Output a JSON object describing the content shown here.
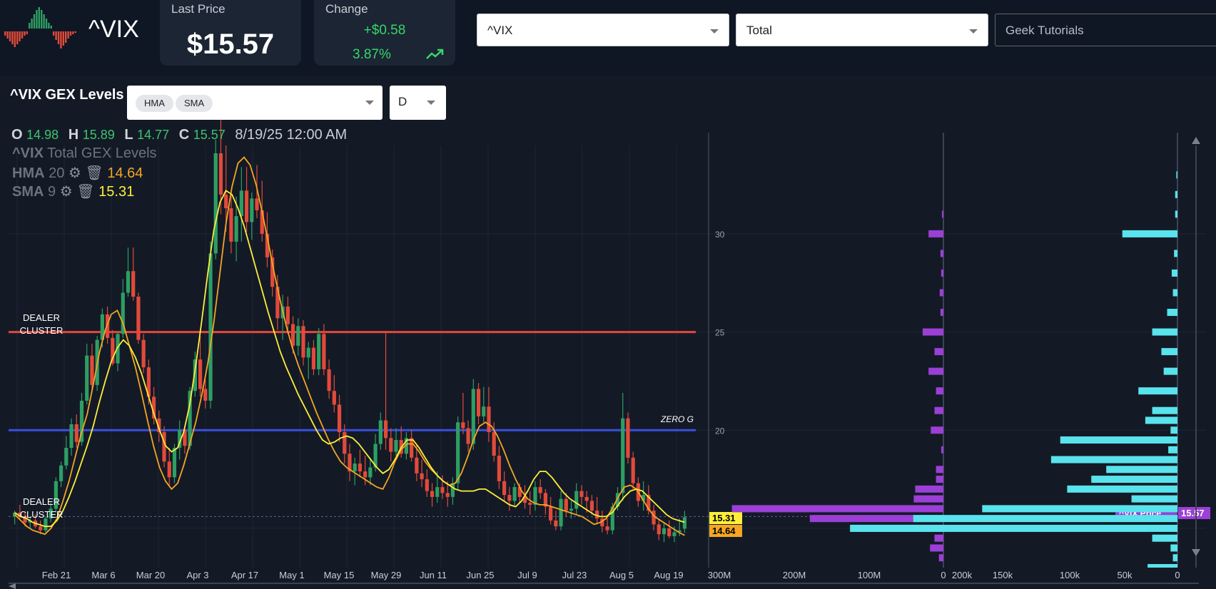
{
  "header": {
    "symbol": "^VIX",
    "last_price_label": "Last Price",
    "last_price": "$15.57",
    "change_label": "Change",
    "change_abs": "+$0.58",
    "change_pct": "3.87%",
    "symbol_select": "^VIX",
    "type_select": "Total",
    "tutorial_select": "Geek Tutorials"
  },
  "panel": {
    "title": "^VIX GEX Levels",
    "indicators": [
      "HMA",
      "SMA"
    ],
    "period": "D",
    "ohlc": {
      "o_label": "O",
      "o": "14.98",
      "h_label": "H",
      "h": "15.89",
      "l_label": "L",
      "l": "14.77",
      "c_label": "C",
      "c": "15.57",
      "datetime": "8/19/25 12:00 AM"
    },
    "legend": {
      "series_title": "^VIX",
      "series_subtitle": "Total GEX Levels",
      "hma_label": "HMA",
      "hma_period": "20",
      "hma_value": "14.64",
      "sma_label": "SMA",
      "sma_period": "9",
      "sma_value": "15.31"
    },
    "level_labels": {
      "dealer_top": [
        "DEALER",
        "CLUSTER"
      ],
      "zero_g": "ZERO G",
      "dealer_bottom": [
        "DEALER",
        "CLUSTER"
      ]
    },
    "price_tags": {
      "sma": "15.31",
      "hma": "14.64",
      "vix_price_label": "^VIX Price",
      "vix_price": "15.57"
    },
    "colors": {
      "up": "#2e9e63",
      "down": "#e24a3b",
      "hma": "#f5a623",
      "sma": "#ffee3a",
      "resistance": "#e6463c",
      "zero_gamma": "#3a4fe0",
      "call_bar": "#59e3ec",
      "put_bar": "#9b3fd6"
    }
  },
  "chart_data": {
    "type": "candlestick",
    "x_tick_labels": [
      "Feb 21",
      "Mar 6",
      "Mar 20",
      "Apr 3",
      "Apr 17",
      "May 1",
      "May 15",
      "May 29",
      "Jun 11",
      "Jun 25",
      "Jul 9",
      "Jul 23",
      "Aug 5",
      "Aug 19"
    ],
    "y_ticks": [
      20,
      25,
      30
    ],
    "ylim": [
      13.0,
      34.5
    ],
    "levels": {
      "dealer_cluster_upper": 25,
      "zero_gamma": 20,
      "dealer_cluster_lower": 15.6
    },
    "candles": [
      [
        15.6,
        15.9,
        15.2,
        15.8
      ],
      [
        15.8,
        16.2,
        15.5,
        15.6
      ],
      [
        15.6,
        15.8,
        15.1,
        15.3
      ],
      [
        15.3,
        15.6,
        15.0,
        15.4
      ],
      [
        15.4,
        15.7,
        15.0,
        15.1
      ],
      [
        15.1,
        15.4,
        14.7,
        14.9
      ],
      [
        14.9,
        15.6,
        14.8,
        15.5
      ],
      [
        15.5,
        16.3,
        15.3,
        16.0
      ],
      [
        16.0,
        17.6,
        15.8,
        17.4
      ],
      [
        17.4,
        18.4,
        17.1,
        18.2
      ],
      [
        18.2,
        19.7,
        18.0,
        19.1
      ],
      [
        19.1,
        20.6,
        18.7,
        20.3
      ],
      [
        20.3,
        20.8,
        19.1,
        19.4
      ],
      [
        19.4,
        21.9,
        19.2,
        21.5
      ],
      [
        21.5,
        24.4,
        21.3,
        23.8
      ],
      [
        23.8,
        24.4,
        21.9,
        22.3
      ],
      [
        22.3,
        24.8,
        22.0,
        24.6
      ],
      [
        24.6,
        26.2,
        24.2,
        25.9
      ],
      [
        25.9,
        26.3,
        24.4,
        24.7
      ],
      [
        24.7,
        25.1,
        23.3,
        23.4
      ],
      [
        23.4,
        25.0,
        23.0,
        24.9
      ],
      [
        24.9,
        27.7,
        24.7,
        27.0
      ],
      [
        27.0,
        29.3,
        26.8,
        28.1
      ],
      [
        28.1,
        29.3,
        26.6,
        26.8
      ],
      [
        26.8,
        27.0,
        24.4,
        24.6
      ],
      [
        24.6,
        24.9,
        22.9,
        23.2
      ],
      [
        23.2,
        23.6,
        21.3,
        21.7
      ],
      [
        21.7,
        22.2,
        20.3,
        20.6
      ],
      [
        20.6,
        21.0,
        19.4,
        19.9
      ],
      [
        19.9,
        20.2,
        18.1,
        18.4
      ],
      [
        18.4,
        19.1,
        17.1,
        17.6
      ],
      [
        17.6,
        19.3,
        17.3,
        19.1
      ],
      [
        19.1,
        20.5,
        18.5,
        20.0
      ],
      [
        20.0,
        20.2,
        18.8,
        19.2
      ],
      [
        19.2,
        22.2,
        19.0,
        22.0
      ],
      [
        22.0,
        24.0,
        21.7,
        23.6
      ],
      [
        23.6,
        24.8,
        21.7,
        22.1
      ],
      [
        22.1,
        22.6,
        21.1,
        21.5
      ],
      [
        21.5,
        29.6,
        21.1,
        29.0
      ],
      [
        29.0,
        34.8,
        28.7,
        34.1
      ],
      [
        34.1,
        36.0,
        31.0,
        32.0
      ],
      [
        32.0,
        34.5,
        30.1,
        31.3
      ],
      [
        31.3,
        32.2,
        29.0,
        29.6
      ],
      [
        29.6,
        31.9,
        28.6,
        30.9
      ],
      [
        30.9,
        33.4,
        29.6,
        32.2
      ],
      [
        32.2,
        33.4,
        30.1,
        30.6
      ],
      [
        30.6,
        32.1,
        29.7,
        31.8
      ],
      [
        31.8,
        33.5,
        30.8,
        31.2
      ],
      [
        31.2,
        32.7,
        29.6,
        30.0
      ],
      [
        30.0,
        31.1,
        28.3,
        28.8
      ],
      [
        28.8,
        29.2,
        26.8,
        27.3
      ],
      [
        27.3,
        27.9,
        25.1,
        25.7
      ],
      [
        25.7,
        26.9,
        24.6,
        26.3
      ],
      [
        26.3,
        26.8,
        24.9,
        25.4
      ],
      [
        25.4,
        25.8,
        23.9,
        24.3
      ],
      [
        24.3,
        25.7,
        23.8,
        25.3
      ],
      [
        25.3,
        25.6,
        23.3,
        23.7
      ],
      [
        23.7,
        24.5,
        22.6,
        24.2
      ],
      [
        24.2,
        24.6,
        22.8,
        23.1
      ],
      [
        23.1,
        25.2,
        22.8,
        24.9
      ],
      [
        24.9,
        25.4,
        22.8,
        23.1
      ],
      [
        23.1,
        23.6,
        21.6,
        22.0
      ],
      [
        22.0,
        22.8,
        20.9,
        21.3
      ],
      [
        21.3,
        21.8,
        19.4,
        19.9
      ],
      [
        19.9,
        20.3,
        18.3,
        18.8
      ],
      [
        18.8,
        19.3,
        17.4,
        17.9
      ],
      [
        17.9,
        18.6,
        17.2,
        18.3
      ],
      [
        18.3,
        19.0,
        17.6,
        17.9
      ],
      [
        17.9,
        18.7,
        17.2,
        17.6
      ],
      [
        17.6,
        18.6,
        17.2,
        18.1
      ],
      [
        18.1,
        19.8,
        17.9,
        19.3
      ],
      [
        19.3,
        20.9,
        19.0,
        20.5
      ],
      [
        20.5,
        25.0,
        19.0,
        19.6
      ],
      [
        19.6,
        20.1,
        18.4,
        18.9
      ],
      [
        18.9,
        20.1,
        18.7,
        19.5
      ],
      [
        19.5,
        20.2,
        18.6,
        18.8
      ],
      [
        18.8,
        19.9,
        18.5,
        19.6
      ],
      [
        19.6,
        20.0,
        18.4,
        18.6
      ],
      [
        18.6,
        19.3,
        17.4,
        17.8
      ],
      [
        17.8,
        18.5,
        17.1,
        17.5
      ],
      [
        17.5,
        18.0,
        16.6,
        16.9
      ],
      [
        16.9,
        17.3,
        16.1,
        16.6
      ],
      [
        16.6,
        17.9,
        16.3,
        17.1
      ],
      [
        17.1,
        17.7,
        16.5,
        16.8
      ],
      [
        16.8,
        17.4,
        16.1,
        16.6
      ],
      [
        16.6,
        17.6,
        16.2,
        17.3
      ],
      [
        17.3,
        20.7,
        17.0,
        20.4
      ],
      [
        20.4,
        21.9,
        19.8,
        20.1
      ],
      [
        20.1,
        20.5,
        18.9,
        19.3
      ],
      [
        19.3,
        22.6,
        19.0,
        22.1
      ],
      [
        22.1,
        22.4,
        20.3,
        20.7
      ],
      [
        20.7,
        22.2,
        20.4,
        21.2
      ],
      [
        21.2,
        22.2,
        19.4,
        19.9
      ],
      [
        19.9,
        20.4,
        18.4,
        18.7
      ],
      [
        18.7,
        19.2,
        17.0,
        17.4
      ],
      [
        17.4,
        17.9,
        16.4,
        16.7
      ],
      [
        16.7,
        17.1,
        15.9,
        16.4
      ],
      [
        16.4,
        17.3,
        16.1,
        17.1
      ],
      [
        17.1,
        17.3,
        16.3,
        16.6
      ],
      [
        16.6,
        17.2,
        16.0,
        16.3
      ],
      [
        16.3,
        16.9,
        15.7,
        16.2
      ],
      [
        16.2,
        17.4,
        15.9,
        17.1
      ],
      [
        17.1,
        17.5,
        16.5,
        16.8
      ],
      [
        16.8,
        17.0,
        15.7,
        16.1
      ],
      [
        16.1,
        16.6,
        15.2,
        15.4
      ],
      [
        15.4,
        15.9,
        14.9,
        15.1
      ],
      [
        15.1,
        16.9,
        14.9,
        16.5
      ],
      [
        16.5,
        16.8,
        15.6,
        15.9
      ],
      [
        15.9,
        16.4,
        15.5,
        16.0
      ],
      [
        16.0,
        17.3,
        15.7,
        16.9
      ],
      [
        16.9,
        17.2,
        16.2,
        16.6
      ],
      [
        16.6,
        16.9,
        15.8,
        16.4
      ],
      [
        16.4,
        16.7,
        15.7,
        15.9
      ],
      [
        15.9,
        16.6,
        15.2,
        15.5
      ],
      [
        15.5,
        15.9,
        14.8,
        15.1
      ],
      [
        15.1,
        15.5,
        14.7,
        14.9
      ],
      [
        14.9,
        16.3,
        14.7,
        16.1
      ],
      [
        16.1,
        17.1,
        15.9,
        16.8
      ],
      [
        16.8,
        21.9,
        16.4,
        20.6
      ],
      [
        20.6,
        20.9,
        18.3,
        18.6
      ],
      [
        18.6,
        18.9,
        17.0,
        17.3
      ],
      [
        17.3,
        17.6,
        16.1,
        16.4
      ],
      [
        16.4,
        17.4,
        15.9,
        16.7
      ],
      [
        16.7,
        17.2,
        15.7,
        15.9
      ],
      [
        15.9,
        16.2,
        14.9,
        15.2
      ],
      [
        15.2,
        15.5,
        14.4,
        14.7
      ],
      [
        14.7,
        15.3,
        14.3,
        15.0
      ],
      [
        15.0,
        15.4,
        14.5,
        14.6
      ],
      [
        14.6,
        15.1,
        14.3,
        14.8
      ],
      [
        14.8,
        15.5,
        14.6,
        14.9
      ],
      [
        14.98,
        15.89,
        14.77,
        15.57
      ]
    ],
    "hma": [
      15.7,
      15.4,
      15.1,
      14.9,
      14.8,
      14.7,
      15.0,
      15.5,
      16.4,
      17.4,
      18.6,
      19.8,
      20.8,
      22.3,
      23.9,
      25.1,
      25.9,
      26.1,
      25.4,
      24.3,
      23.2,
      21.9,
      20.5,
      19.2,
      18.1,
      17.4,
      17.0,
      17.3,
      18.2,
      19.3,
      20.4,
      21.8,
      23.4,
      25.5,
      28.0,
      30.5,
      32.4,
      33.6,
      33.9,
      33.5,
      32.5,
      31.1,
      29.6,
      28.0,
      26.6,
      25.3,
      24.2,
      23.3,
      22.5,
      21.7,
      20.9,
      20.2,
      19.5,
      18.9,
      18.4,
      18.1,
      17.9,
      17.7,
      17.5,
      17.3,
      17.1,
      17.0,
      17.6,
      18.4,
      19.0,
      19.3,
      19.3,
      18.9,
      18.4,
      18.0,
      17.7,
      17.4,
      17.2,
      17.3,
      17.8,
      18.6,
      19.5,
      20.2,
      20.4,
      20.2,
      19.7,
      19.0,
      18.2,
      17.5,
      16.9,
      16.5,
      16.3,
      16.2,
      16.2,
      16.1,
      16.0,
      15.9,
      15.8,
      15.7,
      15.6,
      15.4,
      15.2,
      15.3,
      15.5,
      16.0,
      16.6,
      17.1,
      17.2,
      17.0,
      16.5,
      16.0,
      15.6,
      15.4,
      15.2,
      15.0,
      14.8,
      14.64
    ],
    "sma": [
      15.8,
      15.6,
      15.5,
      15.3,
      15.2,
      15.1,
      15.1,
      15.4,
      15.9,
      16.6,
      17.4,
      18.3,
      19.2,
      20.2,
      21.4,
      22.5,
      23.5,
      24.2,
      24.6,
      24.3,
      23.7,
      22.9,
      21.9,
      20.9,
      20.0,
      19.2,
      18.9,
      19.1,
      19.9,
      21.3,
      23.3,
      25.6,
      28.0,
      30.2,
      31.6,
      32.2,
      32.0,
      31.3,
      30.4,
      29.3,
      28.2,
      27.1,
      26.0,
      25.0,
      24.0,
      23.2,
      22.5,
      21.8,
      21.2,
      20.6,
      20.0,
      19.5,
      19.3,
      19.4,
      19.6,
      19.7,
      19.6,
      19.3,
      18.9,
      18.5,
      18.1,
      17.8,
      18.0,
      18.5,
      19.1,
      19.5,
      19.5,
      19.1,
      18.6,
      18.1,
      17.7,
      17.4,
      17.2,
      17.0,
      16.9,
      16.9,
      16.9,
      17.0,
      17.0,
      16.8,
      16.6,
      16.4,
      16.2,
      16.1,
      16.4,
      16.9,
      17.5,
      17.9,
      17.9,
      17.6,
      17.2,
      16.8,
      16.5,
      16.3,
      16.1,
      15.9,
      15.7,
      15.6,
      15.6,
      15.8,
      16.2,
      16.6,
      16.9,
      17.0,
      16.9,
      16.6,
      16.3,
      16.0,
      15.7,
      15.5,
      15.4,
      15.31
    ],
    "gex_axis_ticks": [
      "300M",
      "200M",
      "100M",
      "0",
      "200k",
      "150k",
      "100k",
      "50k",
      "0"
    ],
    "gex_total": {
      "strikes": [
        33,
        32,
        31,
        30,
        29,
        28,
        27,
        26,
        25,
        24,
        23,
        22,
        21,
        20,
        19,
        18,
        17.5,
        17,
        16.5,
        16,
        15.5,
        15,
        14.5,
        14,
        13.5
      ],
      "values": [
        0,
        0,
        -2,
        -20,
        -4,
        -3,
        -5,
        -4,
        -28,
        -12,
        -20,
        -10,
        -12,
        -17,
        -3,
        -10,
        -10,
        -38,
        -40,
        -285,
        -180,
        -120,
        -12,
        -18,
        -6
      ]
    },
    "gex_other": {
      "strikes": [
        33,
        32,
        31,
        30,
        29,
        28,
        27,
        26,
        25,
        24,
        23,
        22,
        21,
        20.5,
        20,
        19.5,
        19,
        18.5,
        18,
        17.5,
        17,
        16.5,
        16,
        15.5,
        15,
        14.5,
        14,
        13.5,
        13
      ],
      "values": [
        1,
        2,
        2,
        48,
        3,
        5,
        4,
        9,
        22,
        14,
        12,
        34,
        22,
        28,
        6,
        102,
        8,
        110,
        62,
        75,
        96,
        40,
        170,
        230,
        285,
        22,
        6,
        4,
        26
      ]
    }
  }
}
